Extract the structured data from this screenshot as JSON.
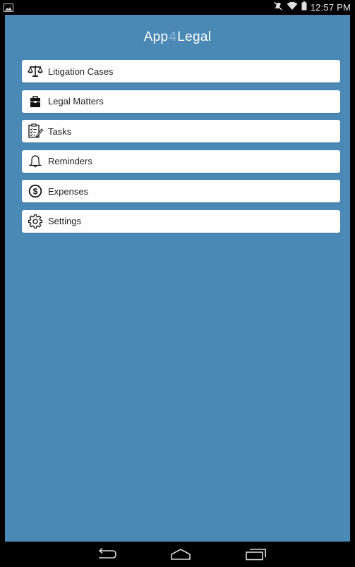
{
  "status_bar": {
    "time": "12:57 PM",
    "icons": [
      "image-notification-icon",
      "mute-icon",
      "wifi-icon",
      "battery-icon"
    ]
  },
  "app": {
    "title_part1": "App",
    "title_sep": "4",
    "title_part2": "Legal",
    "background_color": "#4a88b5"
  },
  "menu": {
    "items": [
      {
        "label": "Litigation Cases",
        "icon": "scales-icon"
      },
      {
        "label": "Legal Matters",
        "icon": "briefcase-icon"
      },
      {
        "label": "Tasks",
        "icon": "task-checklist-icon"
      },
      {
        "label": "Reminders",
        "icon": "bell-icon"
      },
      {
        "label": "Expenses",
        "icon": "dollar-circle-icon"
      },
      {
        "label": "Settings",
        "icon": "gear-icon"
      }
    ]
  },
  "nav_bar": {
    "buttons": [
      "back-icon",
      "home-icon",
      "recents-icon"
    ]
  }
}
